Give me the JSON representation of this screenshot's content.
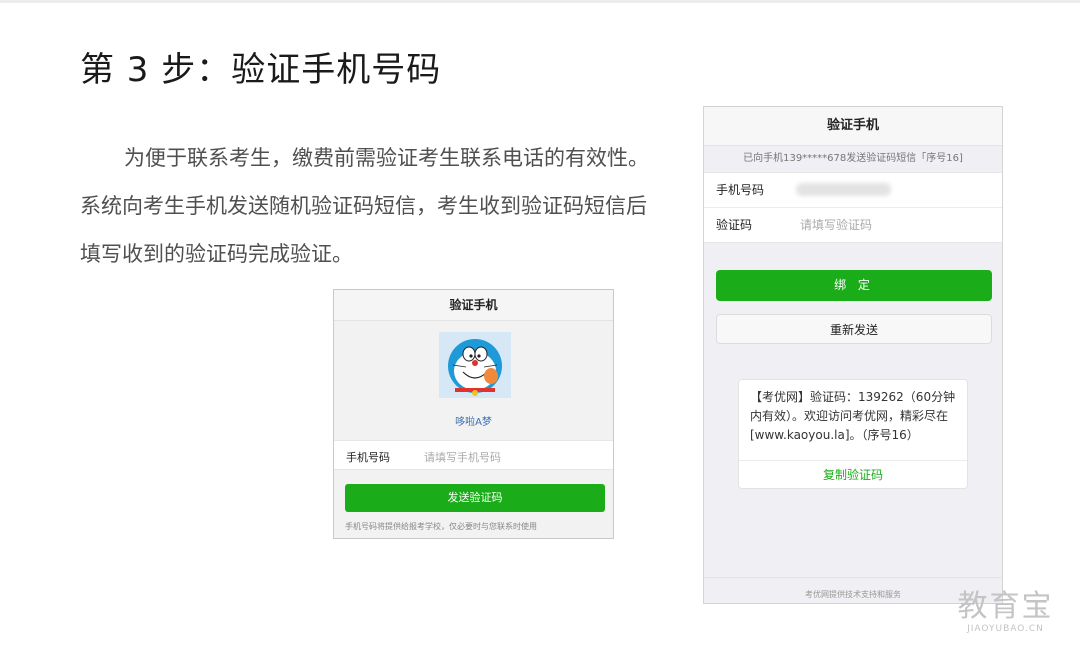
{
  "title": "第 3 步：验证手机号码",
  "paragraph": {
    "line1": "为便于联系考生，缴费前需验证考生联系电话的有效性。",
    "line2": "系统向考生手机发送随机验证码短信，考生收到验证码短信后",
    "line3": "填写收到的验证码完成验证。"
  },
  "screenshot_left": {
    "header": "验证手机",
    "nickname": "哆啦A梦",
    "phone_label": "手机号码",
    "phone_placeholder": "请填写手机号码",
    "send_button": "发送验证码",
    "note": "手机号码将提供给报考学校，仅必要时与您联系时使用",
    "avatar_icon": "doraemon-avatar-icon"
  },
  "screenshot_right": {
    "header": "验证手机",
    "sent_notice": "已向手机139*****678发送验证码短信「序号16]",
    "phone_label": "手机号码",
    "code_label": "验证码",
    "code_placeholder": "请填写验证码",
    "bind_button": "绑 定",
    "resend_button": "重新发送",
    "sms_text": "【考优网】验证码：139262（60分钟内有效）。欢迎访问考优网，精彩尽在[www.kaoyou.la]。（序号16）",
    "copy_button": "复制验证码",
    "footer": "考优网提供技术支持和服务"
  },
  "watermark": {
    "zh": "教育宝",
    "en": "JIAOYUBAO.CN"
  },
  "colors": {
    "primary_green": "#1aad19",
    "link_blue": "#3b6fb0"
  }
}
